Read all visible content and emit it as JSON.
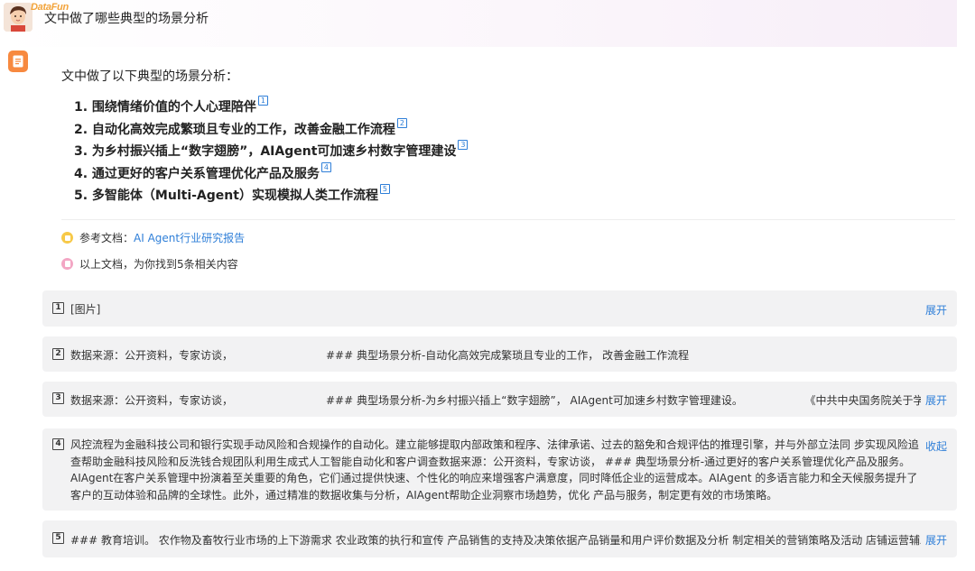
{
  "brand": {
    "name": "DataFun"
  },
  "question": {
    "text": "文中做了哪些典型的场景分析"
  },
  "answer": {
    "intro": "文中做了以下典型的场景分析：",
    "items": [
      {
        "label": "1. 围绕情绪价值的个人心理陪伴",
        "cite": "1"
      },
      {
        "label": "2. 自动化高效完成繁琐且专业的工作，改善金融工作流程",
        "cite": "2"
      },
      {
        "label": "3. 为乡村振兴插上“数字翅膀”，AIAgent可加速乡村数字管理建设",
        "cite": "3"
      },
      {
        "label": "4. 通过更好的客户关系管理优化产品及服务",
        "cite": "4"
      },
      {
        "label": "5. 多智能体（Multi-Agent）实现模拟人类工作流程",
        "cite": "5"
      }
    ],
    "ref_label": "参考文档：",
    "ref_link": "AI Agent行业研究报告",
    "found_text": "以上文档，为你找到5条相关内容"
  },
  "sources": [
    {
      "num": "1",
      "text": "[图片]",
      "toggle": "展开"
    },
    {
      "num": "2",
      "text": "数据来源：公开资料，专家访谈，                           ### 典型场景分析-自动化高效完成繁琐且专业的工作， 改善金融工作流程",
      "toggle": ""
    },
    {
      "num": "3",
      "text": "数据来源：公开资料，专家访谈，                           ### 典型场景分析-为乡村振兴插上“数字翅膀”， AIAgent可加速乡村数字管理建设。                  《中共中央国务院关于学",
      "toggle": "展开"
    },
    {
      "num": "4",
      "text": "风控流程为金融科技公司和银行实现手动风险和合规操作的自动化。建立能够提取内部政策和程序、法律承诺、过去的豁免和合规评估的推理引擎，并与外部立法同 步实现风险追查帮助金融科技风险和反洗钱合规团队利用生成式人工智能自动化和客户调查数据来源：公开资料，专家访谈，                       ### 典型场景分析-通过更好的客户关系管理优化产品及服务。                AIAgent在客户关系管理中扮演着至关重要的角色，它们通过提供快速、个性化的响应来增强客户满意度，同时降低企业的运营成本。AIAgent 的多语言能力和全天候服务提升了客户的互动体验和品牌的全球性。此外，通过精准的数据收集与分析，AIAgent帮助企业洞察市场趋势，优化 产品与服务，制定更有效的市场策略。",
      "toggle": "收起"
    },
    {
      "num": "5",
      "text": "### 教育培训。 农作物及畜牧行业市场的上下游需求 农业政策的执行和宣传 产品销售的支持及决策依据产品销量和用户评价数据及分析 制定相关的营销策略及活动 店铺运营辅助，",
      "toggle": "展开"
    }
  ]
}
